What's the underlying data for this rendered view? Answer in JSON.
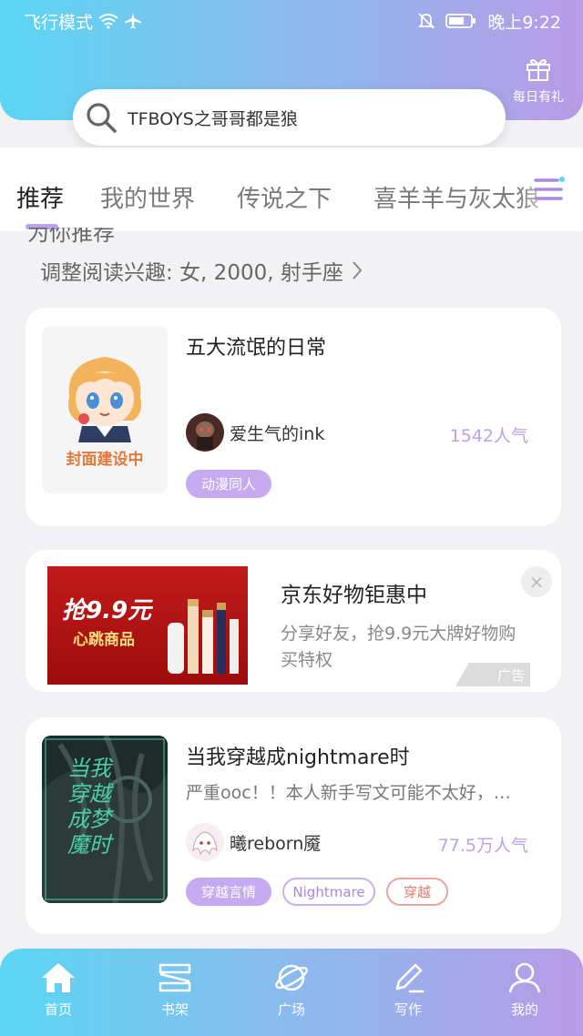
{
  "status_bar": {
    "mode": "飞行模式",
    "time": "晚上9:22"
  },
  "header": {
    "daily_gift_label": "每日有礼"
  },
  "search": {
    "placeholder": "TFBOYS之哥哥都是狼"
  },
  "tabs": [
    {
      "label": "推荐",
      "active": true
    },
    {
      "label": "我的世界",
      "active": false
    },
    {
      "label": "传说之下",
      "active": false
    },
    {
      "label": "喜羊羊与灰太狼",
      "active": false
    }
  ],
  "section": {
    "title_partial": "为你推荐",
    "interest_label": "调整阅读兴趣: 女, 2000, 射手座"
  },
  "cards": [
    {
      "title": "五大流氓的日常",
      "cover_text": "封面建设中",
      "author": "爱生气的ink",
      "popularity": "1542人气",
      "tags": [
        "动漫同人"
      ]
    },
    {
      "title": "当我穿越成nightmare时",
      "cover_text": "当我穿越成梦魔时",
      "description": "严重ooc！！本人新手写文可能不太好，…",
      "author": "曦reborn魇",
      "popularity": "77.5万人气",
      "tags": [
        "穿越言情",
        "Nightmare",
        "穿越"
      ]
    }
  ],
  "ad": {
    "image_text_main": "抢9.9元",
    "image_text_sub": "心跳商品",
    "title": "京东好物钜惠中",
    "description": "分享好友，抢9.9元大牌好物购买特权",
    "badge": "广告",
    "close": "×"
  },
  "bottom_nav": [
    {
      "label": "首页",
      "icon": "home-icon",
      "active": true
    },
    {
      "label": "书架",
      "icon": "bookshelf-icon",
      "active": false
    },
    {
      "label": "广场",
      "icon": "planet-icon",
      "active": false
    },
    {
      "label": "写作",
      "icon": "pen-icon",
      "active": false
    },
    {
      "label": "我的",
      "icon": "user-icon",
      "active": false
    }
  ],
  "colors": {
    "header_gradient_start": "#5bd6f2",
    "header_gradient_end": "#b89be6",
    "accent_purple": "#b9a3ea",
    "tag_red": "#df7a72"
  }
}
